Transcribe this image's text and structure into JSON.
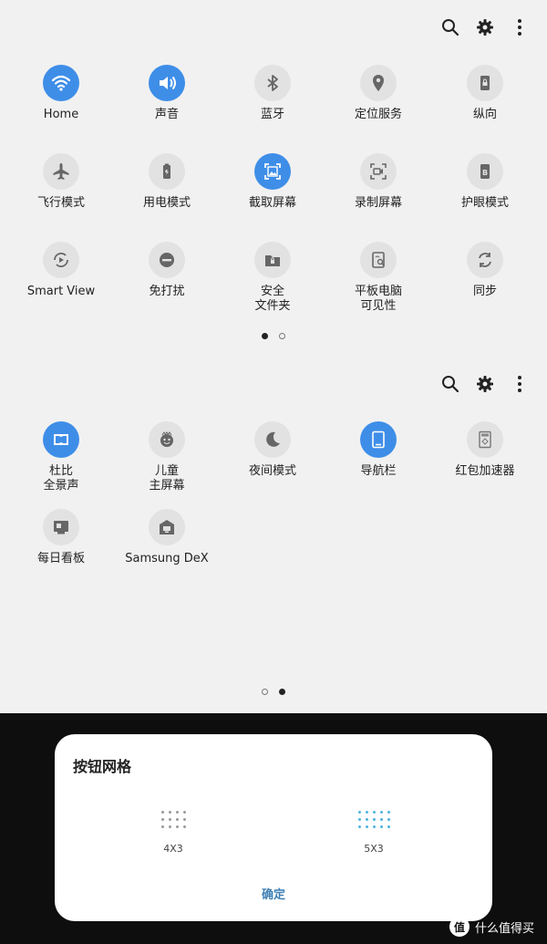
{
  "panel1": {
    "tiles": [
      {
        "label": "Home",
        "icon": "wifi-icon",
        "on": true
      },
      {
        "label": "声音",
        "icon": "volume-icon",
        "on": true
      },
      {
        "label": "蓝牙",
        "icon": "bluetooth-icon",
        "on": false
      },
      {
        "label": "定位服务",
        "icon": "location-icon",
        "on": false
      },
      {
        "label": "纵向",
        "icon": "portrait-lock-icon",
        "on": false
      },
      {
        "label": "飞行模式",
        "icon": "airplane-icon",
        "on": false
      },
      {
        "label": "用电模式",
        "icon": "battery-icon",
        "on": false
      },
      {
        "label": "截取屏幕",
        "icon": "screenshot-icon",
        "on": true
      },
      {
        "label": "录制屏幕",
        "icon": "screen-record-icon",
        "on": false
      },
      {
        "label": "护眼模式",
        "icon": "eye-comfort-icon",
        "on": false
      },
      {
        "label": "Smart View",
        "icon": "smart-view-icon",
        "on": false
      },
      {
        "label": "免打扰",
        "icon": "do-not-disturb-icon",
        "on": false
      },
      {
        "label": "安全\n文件夹",
        "icon": "secure-folder-icon",
        "on": false
      },
      {
        "label": "平板电脑\n可见性",
        "icon": "tablet-visibility-icon",
        "on": false
      },
      {
        "label": "同步",
        "icon": "sync-icon",
        "on": false
      }
    ]
  },
  "panel2": {
    "tiles": [
      {
        "label": "杜比\n全景声",
        "icon": "dolby-atmos-icon",
        "on": true
      },
      {
        "label": "儿童\n主屏幕",
        "icon": "kids-home-icon",
        "on": false
      },
      {
        "label": "夜间模式",
        "icon": "night-mode-icon",
        "on": false
      },
      {
        "label": "导航栏",
        "icon": "navigation-bar-icon",
        "on": true
      },
      {
        "label": "红包加速器",
        "icon": "red-envelope-icon",
        "on": false
      },
      {
        "label": "每日看板",
        "icon": "daily-board-icon",
        "on": false
      },
      {
        "label": "Samsung DeX",
        "icon": "samsung-dex-icon",
        "on": false
      }
    ]
  },
  "toolbar": {
    "icons": [
      "search-icon",
      "gear-icon",
      "more-vertical-icon"
    ]
  },
  "dialog": {
    "title": "按钮网格",
    "options": [
      {
        "label": "4X3",
        "cols": 4,
        "rows": 3,
        "color": "#9a9a9a",
        "selected": false
      },
      {
        "label": "5X3",
        "cols": 5,
        "rows": 3,
        "color": "#4fb3e0",
        "selected": true
      }
    ],
    "confirm": "确定"
  },
  "watermark": {
    "logo": "值",
    "text": "什么值得买"
  },
  "colors": {
    "accent": "#3e8ee8",
    "background": "#f1f1f1",
    "tile_off": "#e2e2e2",
    "confirm": "#3f7fb5"
  }
}
